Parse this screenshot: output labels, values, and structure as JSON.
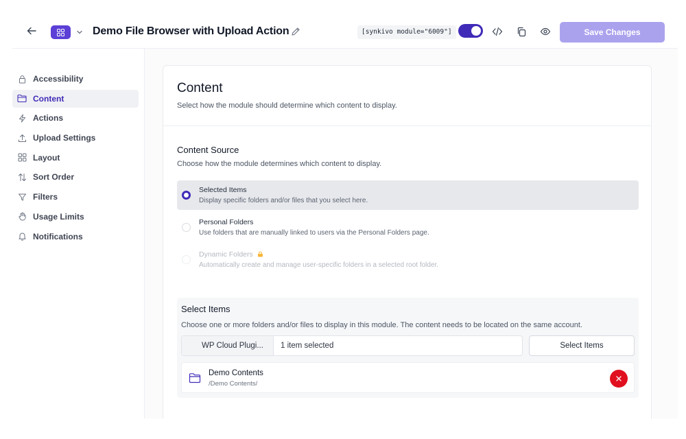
{
  "header": {
    "title": "Demo File Browser with Upload Action",
    "shortcode": "[synkivo module=\"6009\"]",
    "save_label": "Save Changes",
    "module_enabled": true,
    "accent_color": "#3f2bb8",
    "save_color": "#aba2ee",
    "icons": [
      "back-arrow-icon",
      "grid-icon",
      "chevron-down-icon",
      "pencil-icon",
      "code-icon",
      "copy-icon",
      "eye-icon"
    ]
  },
  "sidebar": {
    "items": [
      {
        "label": "Accessibility",
        "icon": "lock-icon",
        "active": false
      },
      {
        "label": "Content",
        "icon": "folder-icon",
        "active": true
      },
      {
        "label": "Actions",
        "icon": "bolt-icon",
        "active": false
      },
      {
        "label": "Upload Settings",
        "icon": "upload-icon",
        "active": false
      },
      {
        "label": "Layout",
        "icon": "grid-icon",
        "active": false
      },
      {
        "label": "Sort Order",
        "icon": "sort-icon",
        "active": false
      },
      {
        "label": "Filters",
        "icon": "filter-icon",
        "active": false
      },
      {
        "label": "Usage Limits",
        "icon": "hand-icon",
        "active": false
      },
      {
        "label": "Notifications",
        "icon": "bell-icon",
        "active": false
      }
    ]
  },
  "content": {
    "title": "Content",
    "description": "Select how the module should determine which content to display.",
    "source": {
      "title": "Content Source",
      "description": "Choose how the module determines which content to display.",
      "options": [
        {
          "label": "Selected Items",
          "description": "Display specific folders and/or files that you select here.",
          "selected": true,
          "disabled": false
        },
        {
          "label": "Personal Folders",
          "description": "Use folders that are manually linked to users via the Personal Folders page.",
          "selected": false,
          "disabled": false
        },
        {
          "label": "Dynamic Folders",
          "description": "Automatically create and manage user-specific folders in a selected root folder.",
          "selected": false,
          "disabled": true
        }
      ]
    },
    "select_items": {
      "title": "Select Items",
      "description": "Choose one or more folders and/or files to display in this module. The content needs to be located on the same account.",
      "account": "WP Cloud Plugi...",
      "count": "1 item selected",
      "button": "Select Items",
      "items": [
        {
          "name": "Demo Contents",
          "path": "/Demo Contents/"
        }
      ],
      "remove_color": "#e0101f"
    }
  }
}
